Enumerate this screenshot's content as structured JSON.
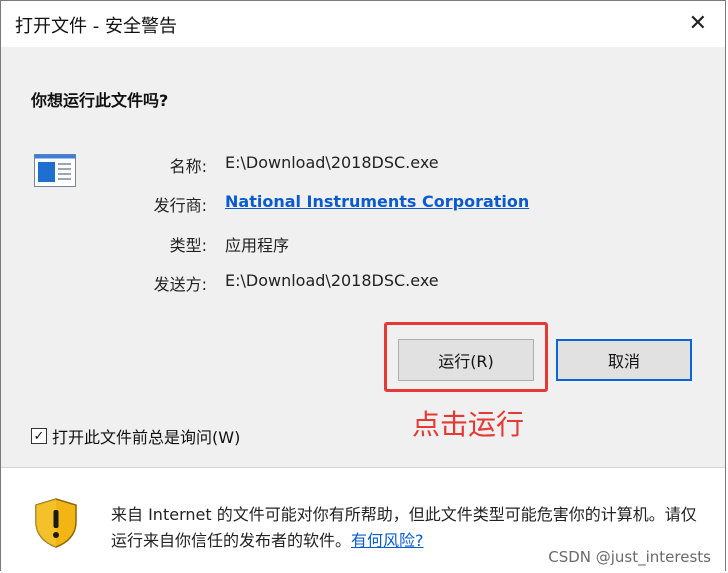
{
  "window": {
    "title": "打开文件 - 安全警告",
    "close_glyph": "✕"
  },
  "prompt": {
    "question": "你想运行此文件吗?"
  },
  "file_info": {
    "rows": [
      {
        "label": "名称:",
        "value": "E:\\Download\\2018DSC.exe"
      },
      {
        "label": "发行商:",
        "value": "National Instruments Corporation"
      },
      {
        "label": "类型:",
        "value": "应用程序"
      },
      {
        "label": "发送方:",
        "value": "E:\\Download\\2018DSC.exe"
      }
    ]
  },
  "buttons": {
    "run": "运行(R)",
    "cancel": "取消"
  },
  "annotation": {
    "text": "点击运行",
    "color": "#e53935"
  },
  "checkbox": {
    "checked": true,
    "mark": "✓",
    "label": "打开此文件前总是询问(W)"
  },
  "footer": {
    "warning_text": "来自 Internet 的文件可能对你有所帮助，但此文件类型可能危害你的计算机。请仅运行来自你信任的发布者的软件。",
    "risk_link": "有何风险?",
    "watermark": "CSDN @just_interests"
  },
  "icons": {
    "file": "application-file-icon",
    "shield": "security-shield-warning-icon"
  },
  "colors": {
    "link": "#0a5bcf",
    "focus_border": "#0a64d8",
    "highlight": "#e53935"
  }
}
